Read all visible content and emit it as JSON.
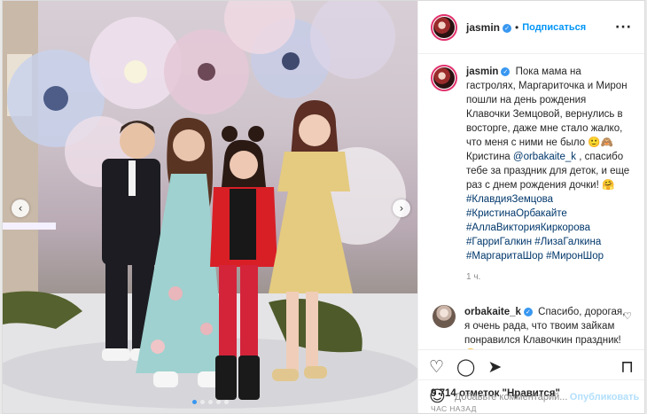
{
  "header": {
    "username": "jasmin",
    "verified_mark": "✓",
    "separator": "•",
    "follow_label": "Подписаться",
    "more_label": "···"
  },
  "caption": {
    "username": "jasmin",
    "text_1": "Пока мама на гастролях, Маргариточка и Мирон пошли на день рождения Клавочки Земцовой, вернулись в восторге, даже мне стало жалко, что меня с ними не было 🙂🙈 Кристина ",
    "mention": "@orbakaite_k",
    "text_2": " , спасибо тебе за праздник для деток, и еще раз с днем рождения дочки! 🤗 ",
    "hashtags": [
      "#КлавдияЗемцова",
      "#КристинаОрбакайте",
      "#АллаВикторияКиркорова",
      "#ГарриГалкин",
      "#ЛизаГалкина",
      "#МаргаритаШор",
      "#МиронШор"
    ],
    "time": "1 ч."
  },
  "reply": {
    "username": "orbakaite_k",
    "text": "Спасибо, дорогая, я очень рада, что твоим зайкам понравился Клавочкин праздник! 😘",
    "like_icon": "♡"
  },
  "actions": {
    "like_icon": "♡",
    "comment_icon": "◯",
    "share_icon": "➤",
    "bookmark_icon": "⊓"
  },
  "likes": "9 714 отметок \"Нравится\"",
  "date": "ЧАС НАЗАД",
  "add_comment": {
    "emoji_icon": "☺",
    "placeholder": "Добавьте комментарий...",
    "publish_label": "Опубликовать"
  },
  "media": {
    "prev_arrow": "‹",
    "next_arrow": "›",
    "dots_count": 5,
    "active_dot": 0
  },
  "colors": {
    "accent": "#0095f6",
    "link": "#00376b",
    "muted": "#8e8e8e"
  }
}
